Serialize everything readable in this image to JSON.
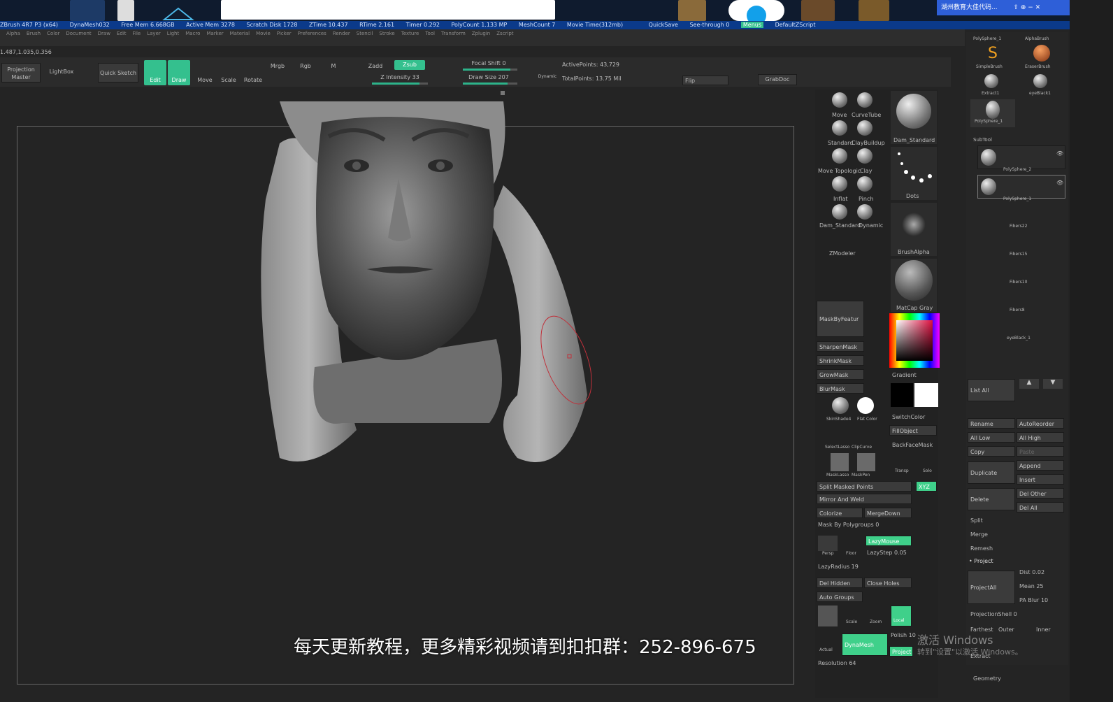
{
  "titlebar": {
    "items": [
      "ZBrush 4R7 P3 (x64)",
      "DynaMesh032",
      "Free Mem 6.668GB",
      "Active Mem 3278",
      "Scratch Disk 1728",
      "ZTime 10.437",
      "RTime 2.161",
      "Timer 0.292",
      "PolyCount 1.133 MP",
      "MeshCount 7",
      "Movie Time(312mb)"
    ],
    "quicksave": "QuickSave",
    "see_through": "See-through 0",
    "menus": "Menus",
    "script": "DefaultZScript"
  },
  "taskbar": {
    "wechat_title": "湖州教育大佳代码..."
  },
  "menubar": [
    "Alpha",
    "Brush",
    "Color",
    "Document",
    "Draw",
    "Edit",
    "File",
    "Layer",
    "Light",
    "Macro",
    "Marker",
    "Material",
    "Movie",
    "Picker",
    "Preferences",
    "Render",
    "Stencil",
    "Stroke",
    "Texture",
    "Tool",
    "Transform",
    "Zplugin",
    "Zscript"
  ],
  "coords": "1.487,1.035,0.356",
  "toolbar": {
    "projection_master": "Projection Master",
    "lightbox": "LightBox",
    "quick_sketch": "Quick Sketch",
    "edit": "Edit",
    "draw": "Draw",
    "move": "Move",
    "scale": "Scale",
    "rotate": "Rotate",
    "mrgb": "Mrgb",
    "rgb": "Rgb",
    "m": "M",
    "zadd": "Zadd",
    "zsub": "Zsub",
    "z_intensity": "Z Intensity 33",
    "z_intensity_value": 33,
    "focal_shift": "Focal Shift 0",
    "draw_size": "Draw Size 207",
    "draw_size_value": 207,
    "dynamic": "Dynamic",
    "active_points": "ActivePoints: 43,729",
    "total_points": "TotalPoints: 13.75 Mil",
    "flip": "Flip",
    "grabdoc": "GrabDoc"
  },
  "subtitle": "每天更新教程，更多精彩视频请到扣扣群：252-896-675",
  "panel1": {
    "brushes": [
      "Move",
      "CurveTube",
      "Standard",
      "ClayBuildup",
      "Move Topologic",
      "Clay",
      "Inflat",
      "Pinch",
      "Dam_Standard",
      "Dynamic"
    ],
    "dam_standard": "Dam_Standard",
    "dots": "Dots",
    "brush_alpha": "BrushAlpha",
    "matcap": "MatCap Gray",
    "zmodeler": "ZModeler",
    "mask_by_feature": "MaskByFeatur",
    "sharpen_mask": "SharpenMask",
    "shrink_mask": "ShrinkMask",
    "grow_mask": "GrowMask",
    "blur_mask": "BlurMask",
    "gradient": "Gradient",
    "switch_color": "SwitchColor",
    "fill_object": "FillObject",
    "backface_mask": "BackFaceMask",
    "skin_shade": "SkinShade4",
    "flat_color": "Flat Color",
    "select_lasso": "SelectLasso",
    "clip_curve": "ClipCurve",
    "mask_lasso": "MaskLasso",
    "mask_pen": "MaskPen",
    "transp": "Transp",
    "solo": "Solo",
    "split_masked": "Split Masked Points",
    "xyz": "XYZ",
    "mirror_weld": "Mirror And Weld",
    "colorize": "Colorize",
    "merge_down": "MergeDown",
    "mask_by_polygroups": "Mask By Polygroups 0",
    "persp": "Persp",
    "floor": "Floor",
    "lazymouse": "LazyMouse",
    "lazystep": "LazyStep 0.05",
    "lazyradius": "LazyRadius 19",
    "del_hidden": "Del Hidden",
    "close_holes": "Close Holes",
    "auto_groups": "Auto Groups",
    "scale": "Scale",
    "zoom": "Zoom",
    "local": "Local",
    "actual": "Actual",
    "dynamesh": "DynaMesh",
    "polish": "Polish 10",
    "project": "Project",
    "resolution": "Resolution 64"
  },
  "panel2": {
    "top_tools": [
      "PolySphere_1",
      "AlphaBrush",
      "SimpleBrush",
      "EraserBrush",
      "Extract1",
      "eyeBlack1",
      "PolySphere_1"
    ],
    "subtool_header": "SubTool",
    "subtools": [
      "PolySphere_2",
      "PolySphere_1",
      "Fibers22",
      "Fibers15",
      "Fibers10",
      "Fibers8",
      "eyeBlack_1"
    ],
    "list_all": "List All",
    "rename": "Rename",
    "auto_reorder": "AutoReorder",
    "all_low": "All Low",
    "all_high": "All High",
    "copy": "Copy",
    "paste": "Paste",
    "append": "Append",
    "duplicate": "Duplicate",
    "insert": "Insert",
    "delete": "Delete",
    "del_other": "Del Other",
    "del_all": "Del All",
    "split": "Split",
    "merge": "Merge",
    "remesh": "Remesh",
    "project": "Project",
    "project_all": "ProjectAll",
    "dist": "Dist 0.02",
    "mean": "Mean 25",
    "pa_blur": "PA Blur 10",
    "projection_shell": "ProjectionShell 0",
    "farthest": "Farthest",
    "outer": "Outer",
    "inner": "Inner",
    "extract": "Extract",
    "geometry": "Geometry"
  },
  "watermark": {
    "line1": "激活 Windows",
    "line2": "转到\"设置\"以激活 Windows。"
  },
  "colors": {
    "accent": "#34c08e",
    "titlebar": "#0b3a8a",
    "background": "#242424"
  }
}
